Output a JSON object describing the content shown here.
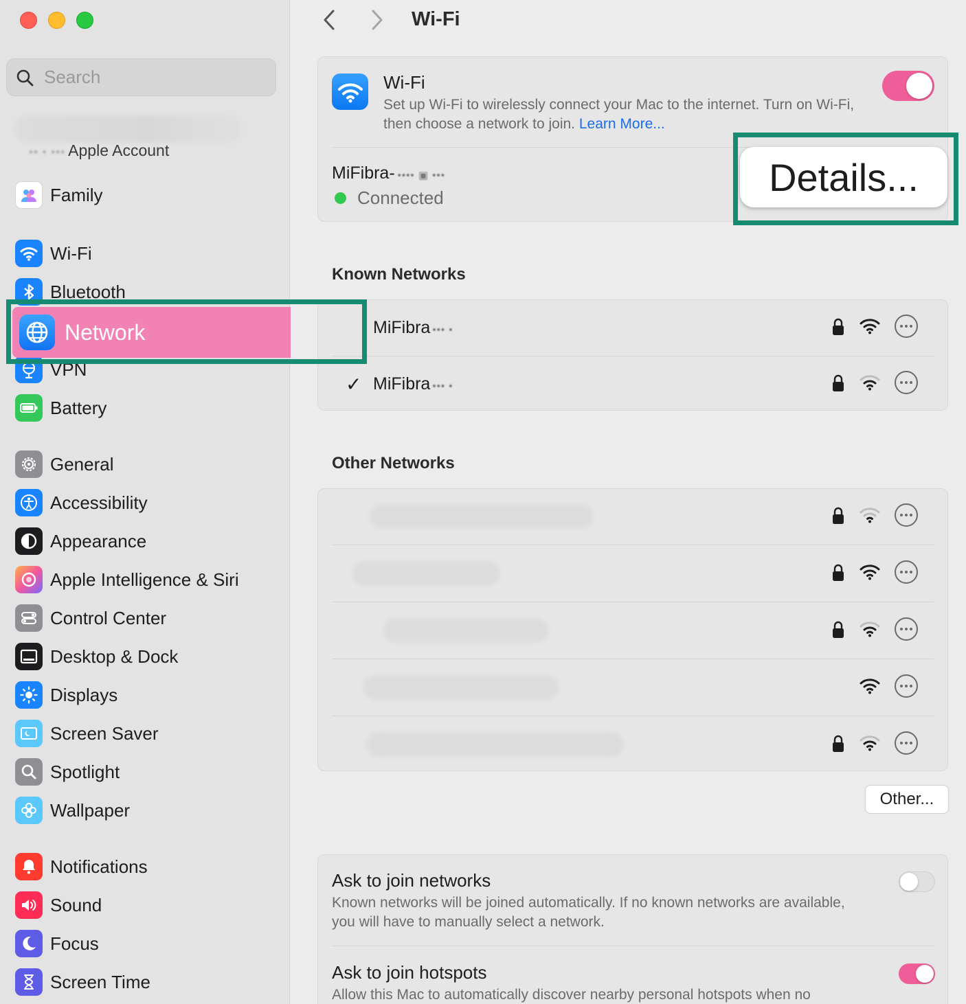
{
  "window": {
    "title": "Wi-Fi"
  },
  "search": {
    "placeholder": "Search"
  },
  "sidebar": {
    "account_label": "Apple Account",
    "account_prefix": "•• • •••",
    "items": [
      {
        "label": "Family",
        "icon": "family-icon",
        "color": "#ffffff"
      },
      {
        "label": "Wi-Fi",
        "icon": "wifi-icon",
        "color": "#1a84ff"
      },
      {
        "label": "Bluetooth",
        "icon": "bluetooth-icon",
        "color": "#1a84ff"
      },
      {
        "label": "Network",
        "icon": "globe-icon",
        "color": "#1a84ff",
        "selected": true
      },
      {
        "label": "VPN",
        "icon": "vpn-icon",
        "color": "#1a84ff"
      },
      {
        "label": "Battery",
        "icon": "battery-icon",
        "color": "#34c759"
      },
      {
        "label": "General",
        "icon": "gear-icon",
        "color": "#8e8e93"
      },
      {
        "label": "Accessibility",
        "icon": "accessibility-icon",
        "color": "#1a84ff"
      },
      {
        "label": "Appearance",
        "icon": "appearance-icon",
        "color": "#1d1d1f"
      },
      {
        "label": "Apple Intelligence & Siri",
        "icon": "siri-icon",
        "color": "#f26aa6"
      },
      {
        "label": "Control Center",
        "icon": "control-center-icon",
        "color": "#8e8e93"
      },
      {
        "label": "Desktop & Dock",
        "icon": "dock-icon",
        "color": "#1d1d1f"
      },
      {
        "label": "Displays",
        "icon": "displays-icon",
        "color": "#1a84ff"
      },
      {
        "label": "Screen Saver",
        "icon": "screen-saver-icon",
        "color": "#5ac8fa"
      },
      {
        "label": "Spotlight",
        "icon": "spotlight-icon",
        "color": "#8e8e93"
      },
      {
        "label": "Wallpaper",
        "icon": "wallpaper-icon",
        "color": "#5ac8fa"
      },
      {
        "label": "Notifications",
        "icon": "notifications-icon",
        "color": "#ff3b30"
      },
      {
        "label": "Sound",
        "icon": "sound-icon",
        "color": "#ff2d55"
      },
      {
        "label": "Focus",
        "icon": "focus-icon",
        "color": "#5e5ce6"
      },
      {
        "label": "Screen Time",
        "icon": "screen-time-icon",
        "color": "#5e5ce6"
      }
    ]
  },
  "wifi": {
    "title": "Wi-Fi",
    "description": "Set up Wi-Fi to wirelessly connect your Mac to the internet. Turn on Wi-Fi, then choose a network to join.",
    "learn_more": "Learn More...",
    "enabled": true,
    "connected_name": "MiFibra-",
    "connected_suffix": "•••• ▣ •••",
    "status": "Connected",
    "details_label": "Details..."
  },
  "known_networks": {
    "title": "Known Networks",
    "rows": [
      {
        "name": "MiFibra",
        "suffix": "••• •",
        "checked": false,
        "secured": true,
        "signal": 3
      },
      {
        "name": "MiFibra",
        "suffix": "••• •",
        "checked": true,
        "secured": true,
        "signal": 2
      }
    ],
    "check_glyph": "✓"
  },
  "other_networks": {
    "title": "Other Networks",
    "rows": [
      {
        "secured": true,
        "signal": 1
      },
      {
        "secured": true,
        "signal": 3
      },
      {
        "secured": true,
        "signal": 2
      },
      {
        "secured": false,
        "signal": 3
      },
      {
        "secured": true,
        "signal": 2
      }
    ],
    "other_button": "Other..."
  },
  "preferences": {
    "ask_networks": {
      "title": "Ask to join networks",
      "description": "Known networks will be joined automatically. If no known networks are available, you will have to manually select a network.",
      "enabled": false
    },
    "ask_hotspots": {
      "title": "Ask to join hotspots",
      "description": "Allow this Mac to automatically discover nearby personal hotspots when no",
      "enabled": true
    }
  },
  "colors": {
    "accent": "#ee5e99",
    "highlight_box": "#178a72",
    "selection": "#f382b4",
    "link": "#1a6ef0"
  }
}
